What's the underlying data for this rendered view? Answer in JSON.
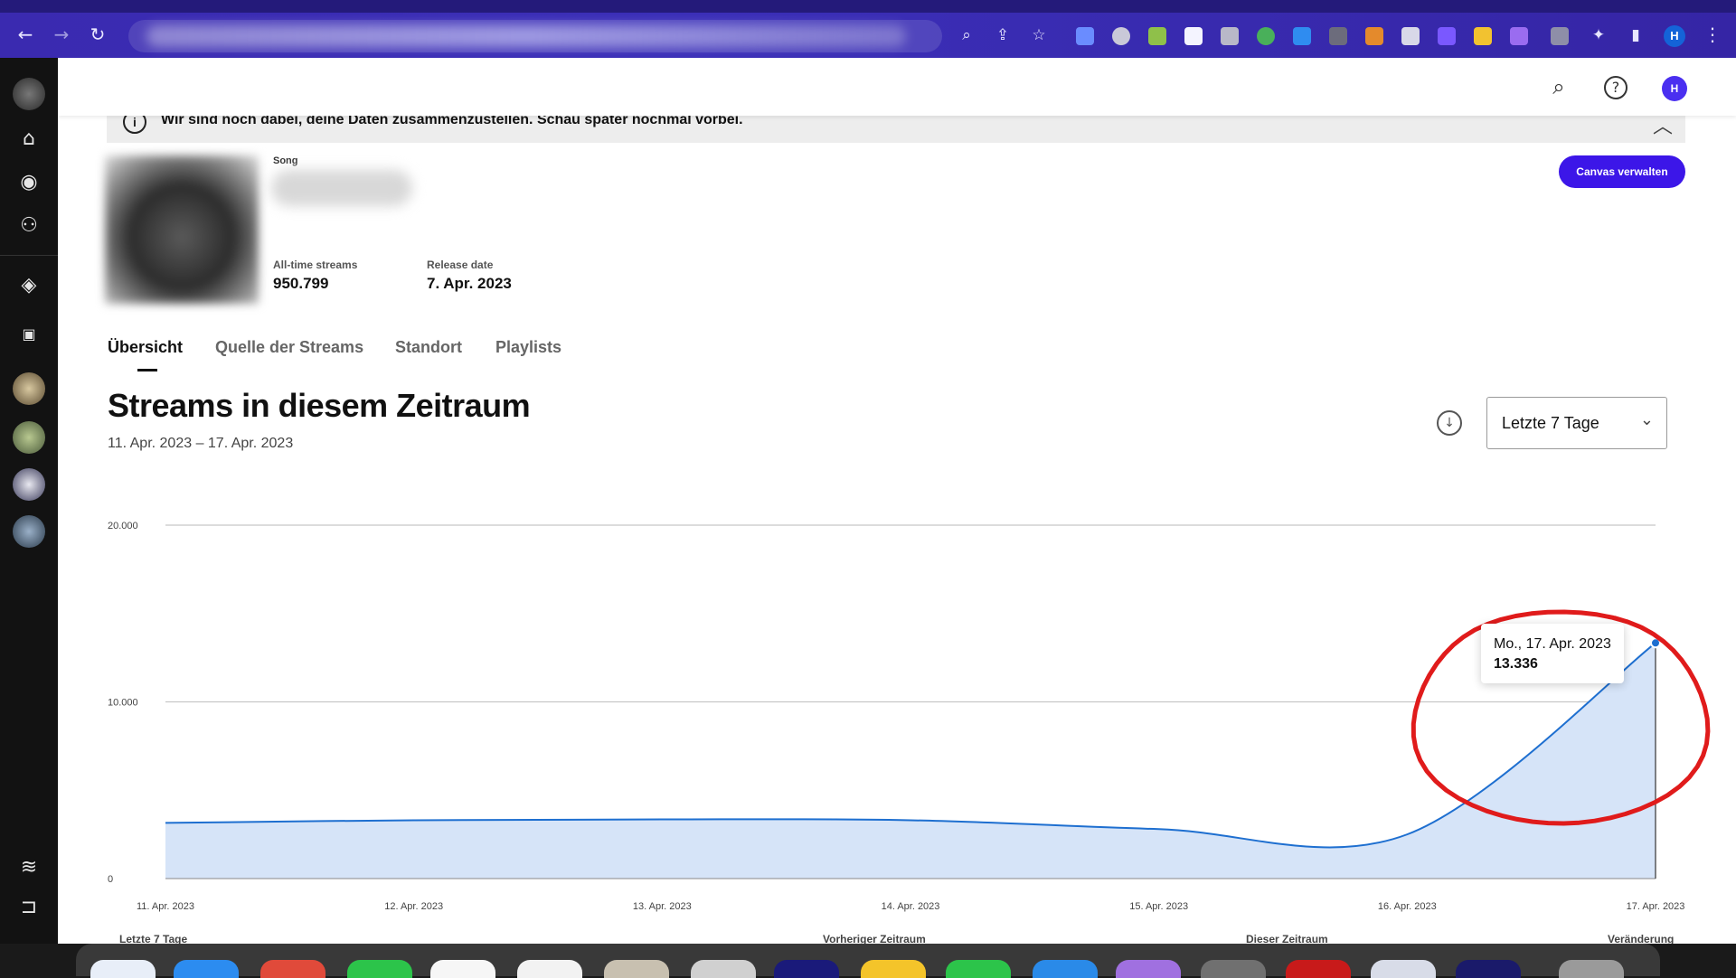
{
  "browser": {
    "back_glyph": "←",
    "forward_glyph": "→",
    "reload_glyph": "↻",
    "profile_initial": "H",
    "menu_glyph": "⋮"
  },
  "sidebar": {
    "items": [
      {
        "name": "home-icon",
        "glyph": "⌂"
      },
      {
        "name": "releases-icon",
        "glyph": "◉"
      },
      {
        "name": "audience-icon",
        "glyph": "⚇"
      },
      {
        "name": "campaigns-icon",
        "glyph": "◈"
      },
      {
        "name": "label-icon",
        "glyph": "▣"
      }
    ],
    "footer": [
      {
        "name": "spotify-icon",
        "glyph": "≋"
      },
      {
        "name": "collapse-sidebar-icon",
        "glyph": "⊐"
      }
    ]
  },
  "topbar": {
    "search_glyph": "⌕",
    "help_glyph": "?",
    "avatar_initial": "H"
  },
  "banner": {
    "icon": "i",
    "text": "Wir sind noch dabei, deine Daten zusammenzustellen. Schau später nochmal vorbei.",
    "collapse_glyph": "︿"
  },
  "song": {
    "type_label": "Song",
    "all_time_label": "All-time streams",
    "all_time_value": "950.799",
    "release_label": "Release date",
    "release_value": "7. Apr. 2023",
    "canvas_button": "Canvas verwalten"
  },
  "tabs": [
    {
      "label": "Übersicht",
      "active": true
    },
    {
      "label": "Quelle der Streams",
      "active": false
    },
    {
      "label": "Standort",
      "active": false
    },
    {
      "label": "Playlists",
      "active": false
    }
  ],
  "section": {
    "title": "Streams in diesem Zeitraum",
    "range": "11. Apr. 2023 – 17. Apr. 2023",
    "download_glyph": "↓",
    "period_selected": "Letzte 7 Tage",
    "period_chevron": "⌄"
  },
  "tooltip": {
    "date": "Mo., 17. Apr. 2023",
    "value": "13.336"
  },
  "bottom_labels": {
    "left": "Letzte 7 Tage",
    "previous": "Vorheriger Zeitraum",
    "current": "Dieser Zeitraum",
    "change": "Veränderung"
  },
  "colors": {
    "accent": "#3c16e8",
    "line": "#1e6fd0",
    "area": "#d6e4f8",
    "annotation": "#e01b1b"
  },
  "chart_data": {
    "type": "area",
    "x": [
      "11. Apr. 2023",
      "12. Apr. 2023",
      "13. Apr. 2023",
      "14. Apr. 2023",
      "15. Apr. 2023",
      "16. Apr. 2023",
      "17. Apr. 2023"
    ],
    "series": [
      {
        "values": [
          3150,
          3300,
          3350,
          3300,
          2800,
          2500,
          13336
        ]
      }
    ],
    "y_ticks": [
      "0",
      "10.000",
      "20.000"
    ],
    "ylim": [
      0,
      20000
    ],
    "grid": true,
    "highlight_point": {
      "x": "17. Apr. 2023",
      "value": 13336
    }
  }
}
